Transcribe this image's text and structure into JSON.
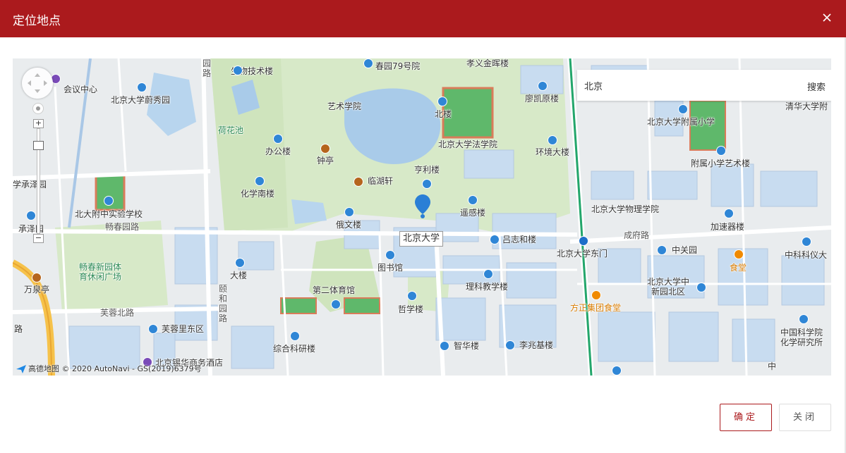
{
  "dialog": {
    "title": "定位地点",
    "close_icon": "close-icon",
    "confirm_label": "确定",
    "close_label": "关闭"
  },
  "search": {
    "value": "北京",
    "button_label": "搜索"
  },
  "map": {
    "zoom_in": "+",
    "zoom_out": "−",
    "callout": "北京大学",
    "copyright": "高德地图 © 2020 AutoNavi - GS(2019)6379号",
    "labels": {
      "l_hypo": "北京大学蔚秀园",
      "l_meeting": "会议中心",
      "l_shengwu": "生物技术楼",
      "l_chun79": "春园79号院",
      "l_xiaoyi": "孝义金晖楼",
      "l_yishu": "艺术学院",
      "l_beilou": "北楼",
      "l_liaokai": "廖凯原楼",
      "l_hehua": "荷花池",
      "l_bangong": "办公楼",
      "l_zhongting": "钟亭",
      "l_falv": "北京大学法学院",
      "l_huanjing": "环境大楼",
      "l_hengli": "亨利楼",
      "l_linhu": "临湖轩",
      "l_huaxue": "化学南楼",
      "l_xuecheng": "学承泽园",
      "l_beidafz": "北大附中实验学校",
      "l_changchun": "畅春园路",
      "l_chengze": "承泽园",
      "l_ewen": "俄文楼",
      "l_yaogan": "遥感楼",
      "l_lvzhi": "吕志和楼",
      "l_changchunxin": "畅春新园体\n育休闲广场",
      "l_dalou": "大楼",
      "l_tushu": "图书馆",
      "l_wanquan": "万泉亭",
      "l_yiheyuan": "颐\n和\n园\n路",
      "l_dier": "第二体育馆",
      "l_like": "理科教学楼",
      "l_zhexue": "哲学楼",
      "l_furong": "芙蓉北路",
      "l_furongli": "芙蓉里东区",
      "l_zonghe": "综合科研楼",
      "l_zhihua": "智华楼",
      "l_lizhao": "李兆基楼",
      "l_xijin": "北京锡华商务酒店",
      "l_qinghua": "清华大学附",
      "l_fushu": "北京大学附属小学",
      "l_fushuyishu": "附属小学艺术楼",
      "l_wuli": "北京大学物理学院",
      "l_jiasu": "加速器楼",
      "l_chengfu": "成府路",
      "l_dongmen": "北京大学东门",
      "l_zhongguanyuan": "中关园",
      "l_shitang": "食堂",
      "l_zhongke": "中科科仪大",
      "l_xinyuan": "北京大学中\n新园北区",
      "l_fangzheng": "方正集团食堂",
      "l_huaxuesuo": "中国科学院\n化学研究所",
      "l_lu": "路",
      "l_yuanlu": "园\n路",
      "l_zhong": "中"
    }
  }
}
